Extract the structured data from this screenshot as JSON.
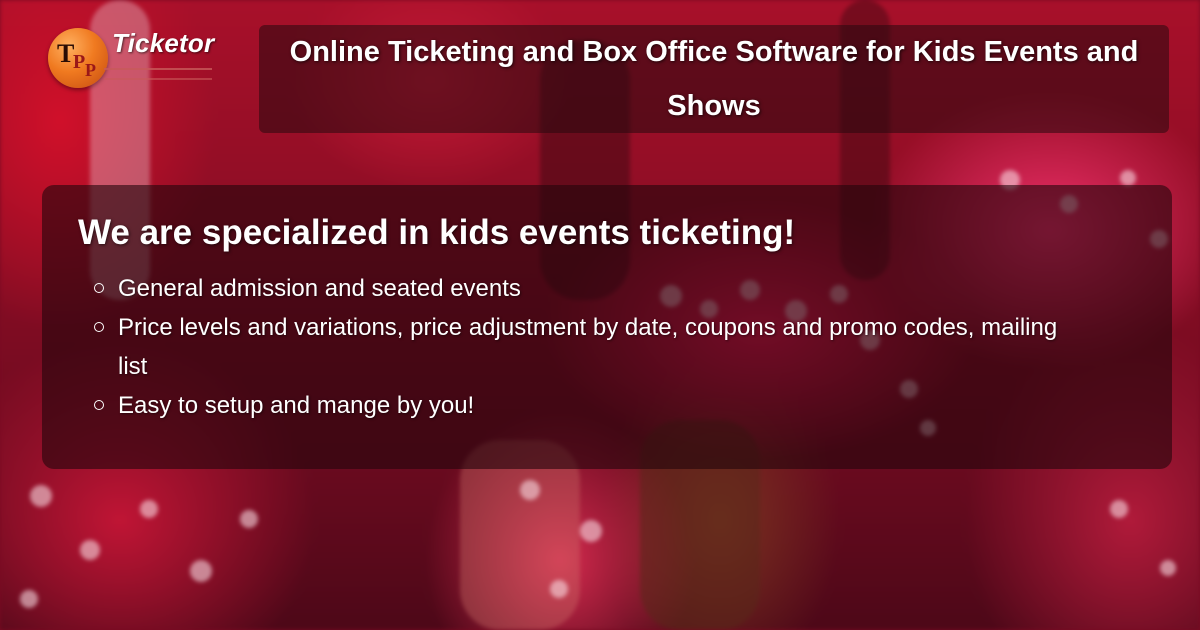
{
  "brand": {
    "name": "Ticketor",
    "badge_letters": "TPP",
    "colors": {
      "badge": "#f07a20",
      "accent": "#c84a4a"
    }
  },
  "header": {
    "title": "Online Ticketing and Box Office Software for Kids Events and Shows"
  },
  "main": {
    "heading": "We are specialized in kids events ticketing!",
    "features": [
      "General admission and seated events",
      "Price levels and variations, price adjustment by date, coupons and promo codes, mailing list",
      "Easy to setup and mange by you!"
    ]
  },
  "background": {
    "description_icon": "kids-dance-photo"
  }
}
